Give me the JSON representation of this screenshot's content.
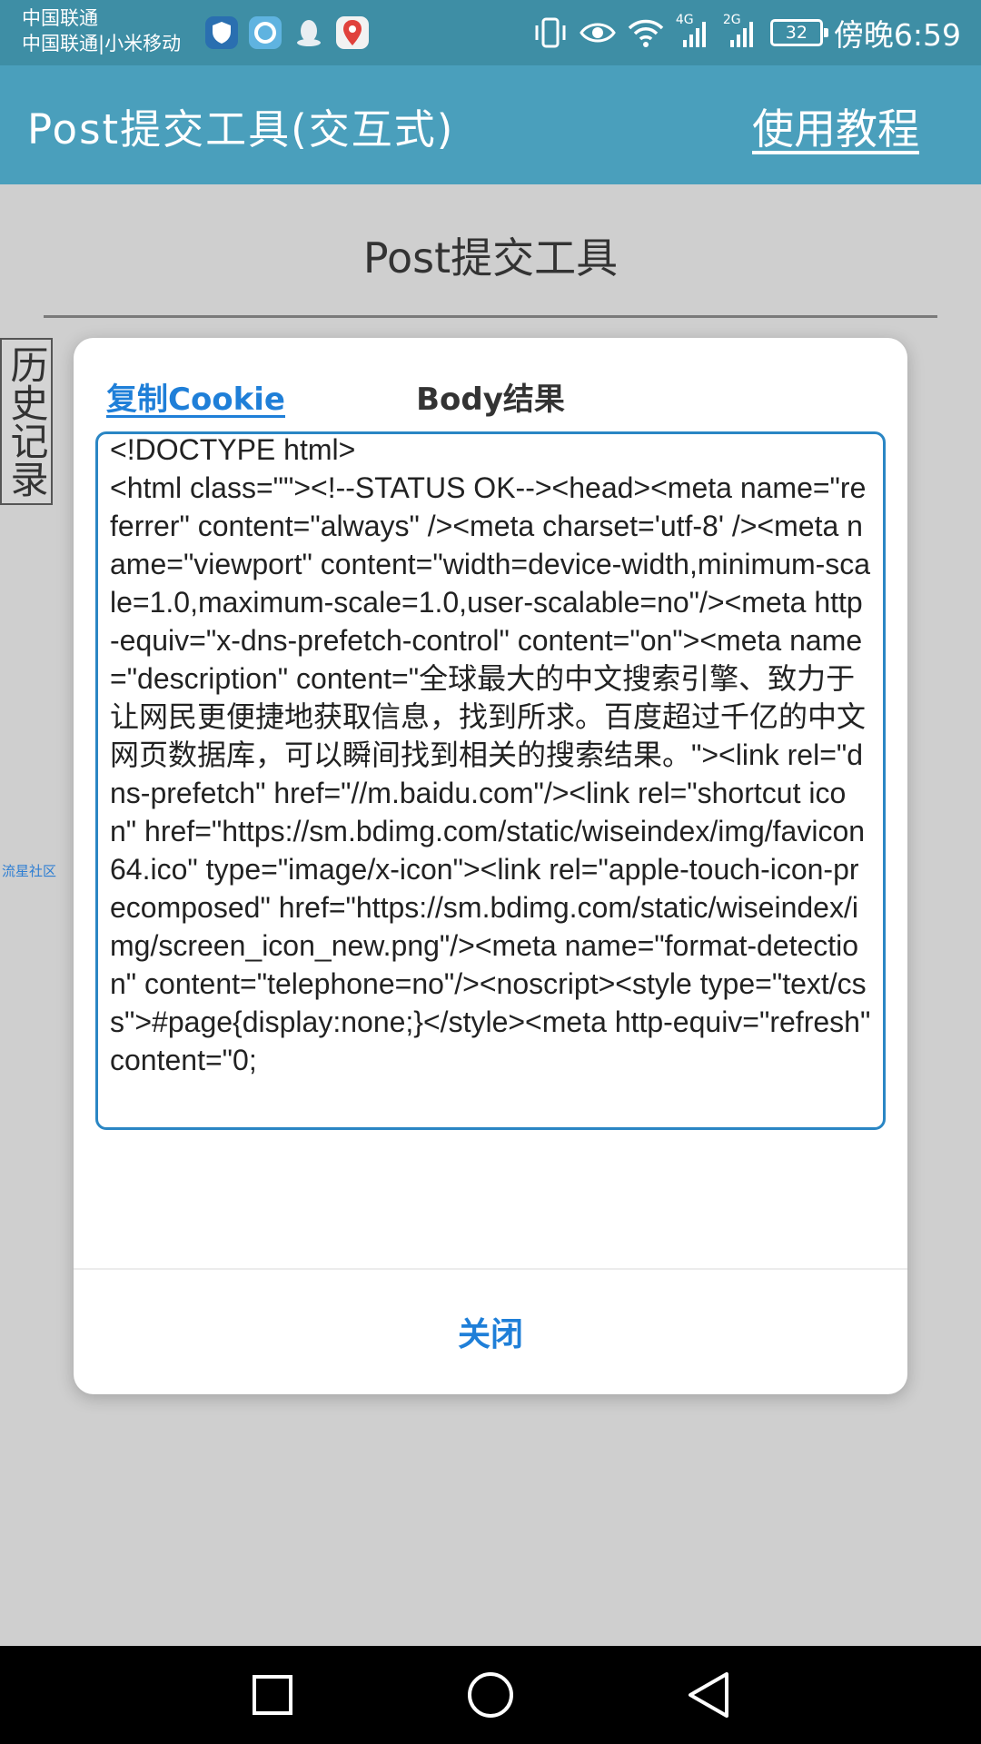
{
  "status_bar": {
    "carrier_line1": "中国联通",
    "carrier_line2": "中国联通|小米移动",
    "network_4g": "4G",
    "network_2g": "2G",
    "battery_level": "32",
    "time": "傍晚6:59"
  },
  "app_bar": {
    "title": "Post提交工具(交互式)",
    "help_label": "使用教程",
    "color": "#4a9fbc"
  },
  "page": {
    "title": "Post提交工具",
    "history_label": "历史记录",
    "community_label": "流星社区"
  },
  "dialog": {
    "copy_cookie_label": "复制Cookie",
    "title": "Body结果",
    "body_text": "<!DOCTYPE html>\n<html class=\"\"><!--STATUS OK--><head><meta name=\"referrer\" content=\"always\" /><meta charset='utf-8' /><meta name=\"viewport\" content=\"width=device-width,minimum-scale=1.0,maximum-scale=1.0,user-scalable=no\"/><meta http-equiv=\"x-dns-prefetch-control\" content=\"on\"><meta name=\"description\" content=\"全球最大的中文搜索引擎、致力于让网民更便捷地获取信息，找到所求。百度超过千亿的中文网页数据库，可以瞬间找到相关的搜索结果。\"><link rel=\"dns-prefetch\" href=\"//m.baidu.com\"/><link rel=\"shortcut icon\" href=\"https://sm.bdimg.com/static/wiseindex/img/favicon64.ico\" type=\"image/x-icon\"><link rel=\"apple-touch-icon-precomposed\" href=\"https://sm.bdimg.com/static/wiseindex/img/screen_icon_new.png\"/><meta name=\"format-detection\" content=\"telephone=no\"/><noscript><style type=\"text/css\">#page{display:none;}</style><meta http-equiv=\"refresh\" content=\"0;",
    "close_label": "关闭",
    "accent_color": "#1f7fd8"
  },
  "icons": {
    "notifications": [
      "shield-icon",
      "browser-icon",
      "qq-penguin-icon",
      "map-pin-icon"
    ],
    "system": [
      "vibrate-icon",
      "eye-icon",
      "wifi-icon",
      "signal-icon",
      "signal-icon",
      "battery-icon"
    ],
    "navigation": [
      "recents-square-icon",
      "home-circle-icon",
      "back-triangle-icon"
    ]
  }
}
